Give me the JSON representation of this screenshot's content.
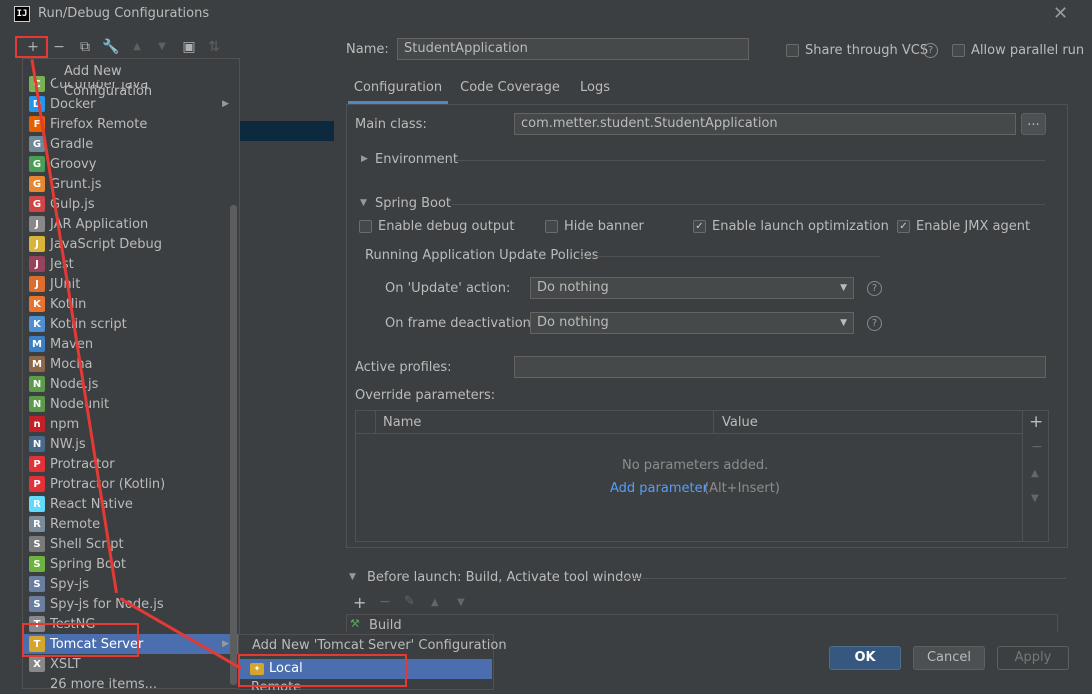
{
  "window": {
    "title": "Run/Debug Configurations",
    "icon": "intellij-icon"
  },
  "toolbar": {
    "add": "+",
    "remove": "−",
    "copy": "⧉",
    "edit": "🔧",
    "up": "▲",
    "down": "▼",
    "folder": "▣",
    "sort": "⇅"
  },
  "form": {
    "name_label": "Name:",
    "name_value": "StudentApplication",
    "share_vcs": "Share through VCS",
    "allow_parallel": "Allow parallel run"
  },
  "tabs": [
    "Configuration",
    "Code Coverage",
    "Logs"
  ],
  "config": {
    "main_class_label": "Main class:",
    "main_class_value": "com.metter.student.StudentApplication",
    "browse": "...",
    "environment": "Environment",
    "spring_boot": "Spring Boot",
    "enable_debug": "Enable debug output",
    "hide_banner": "Hide banner",
    "enable_launch_opt": "Enable launch optimization",
    "enable_jmx": "Enable JMX agent",
    "update_policies": "Running Application Update Policies",
    "on_update_label": "On 'Update' action:",
    "on_update_value": "Do nothing",
    "on_frame_label": "On frame deactivation:",
    "on_frame_value": "Do nothing",
    "active_profiles_label": "Active profiles:",
    "override_label": "Override parameters:",
    "col_name": "Name",
    "col_value": "Value",
    "no_params": "No parameters added.",
    "add_param": "Add parameter",
    "add_param_hint": "(Alt+Insert)"
  },
  "before_launch": {
    "title": "Before launch: Build, Activate tool window",
    "item": "Build"
  },
  "buttons": {
    "ok": "OK",
    "cancel": "Cancel",
    "apply": "Apply"
  },
  "dropdown": {
    "tooltip": "Add New Configuration",
    "items": [
      {
        "label": "Cucumber java",
        "icon": "cucumber-icon",
        "color": "#77b255"
      },
      {
        "label": "Docker",
        "icon": "docker-icon",
        "color": "#2496ed"
      },
      {
        "label": "Firefox Remote",
        "icon": "firefox-icon",
        "color": "#e66000"
      },
      {
        "label": "Gradle",
        "icon": "gradle-icon",
        "color": "#6e8a96"
      },
      {
        "label": "Groovy",
        "icon": "groovy-icon",
        "color": "#4b9e56"
      },
      {
        "label": "Grunt.js",
        "icon": "grunt-icon",
        "color": "#e48632"
      },
      {
        "label": "Gulp.js",
        "icon": "gulp-icon",
        "color": "#cf4647"
      },
      {
        "label": "JAR Application",
        "icon": "jar-icon",
        "color": "#888888"
      },
      {
        "label": "JavaScript Debug",
        "icon": "js-debug-icon",
        "color": "#d9b43a"
      },
      {
        "label": "Jest",
        "icon": "jest-icon",
        "color": "#99425b"
      },
      {
        "label": "JUnit",
        "icon": "junit-icon",
        "color": "#db6d2f"
      },
      {
        "label": "Kotlin",
        "icon": "kotlin-icon",
        "color": "#e8722e"
      },
      {
        "label": "Kotlin script",
        "icon": "kotlin-script-icon",
        "color": "#4d8fd1"
      },
      {
        "label": "Maven",
        "icon": "maven-icon",
        "color": "#3b7fc4"
      },
      {
        "label": "Mocha",
        "icon": "mocha-icon",
        "color": "#8d6748"
      },
      {
        "label": "Node.js",
        "icon": "nodejs-icon",
        "color": "#5b9b49"
      },
      {
        "label": "Nodeunit",
        "icon": "nodeunit-icon",
        "color": "#5b9b49"
      },
      {
        "label": "npm",
        "icon": "npm-icon",
        "color": "#c12127"
      },
      {
        "label": "NW.js",
        "icon": "nwjs-icon",
        "color": "#4a6a8a"
      },
      {
        "label": "Protractor",
        "icon": "protractor-icon",
        "color": "#e23237"
      },
      {
        "label": "Protractor (Kotlin)",
        "icon": "protractor-kotlin-icon",
        "color": "#e23237"
      },
      {
        "label": "React Native",
        "icon": "react-icon",
        "color": "#61dafb"
      },
      {
        "label": "Remote",
        "icon": "remote-icon",
        "color": "#7a8c99"
      },
      {
        "label": "Shell Script",
        "icon": "shell-icon",
        "color": "#7a7a7a"
      },
      {
        "label": "Spring Boot",
        "icon": "spring-boot-icon",
        "color": "#6db33f"
      },
      {
        "label": "Spy-js",
        "icon": "spyjs-icon",
        "color": "#6a7fa0"
      },
      {
        "label": "Spy-js for Node.js",
        "icon": "spyjs-node-icon",
        "color": "#6a7fa0"
      },
      {
        "label": "TestNG",
        "icon": "testng-icon",
        "color": "#888888"
      },
      {
        "label": "Tomcat Server",
        "icon": "tomcat-icon",
        "color": "#d4a72c"
      },
      {
        "label": "XSLT",
        "icon": "xslt-icon",
        "color": "#888888"
      },
      {
        "label": "26 more items...",
        "icon": "",
        "color": ""
      }
    ]
  },
  "submenu": {
    "header": "Add New 'Tomcat Server' Configuration",
    "local": "Local",
    "remote": "Remote"
  }
}
